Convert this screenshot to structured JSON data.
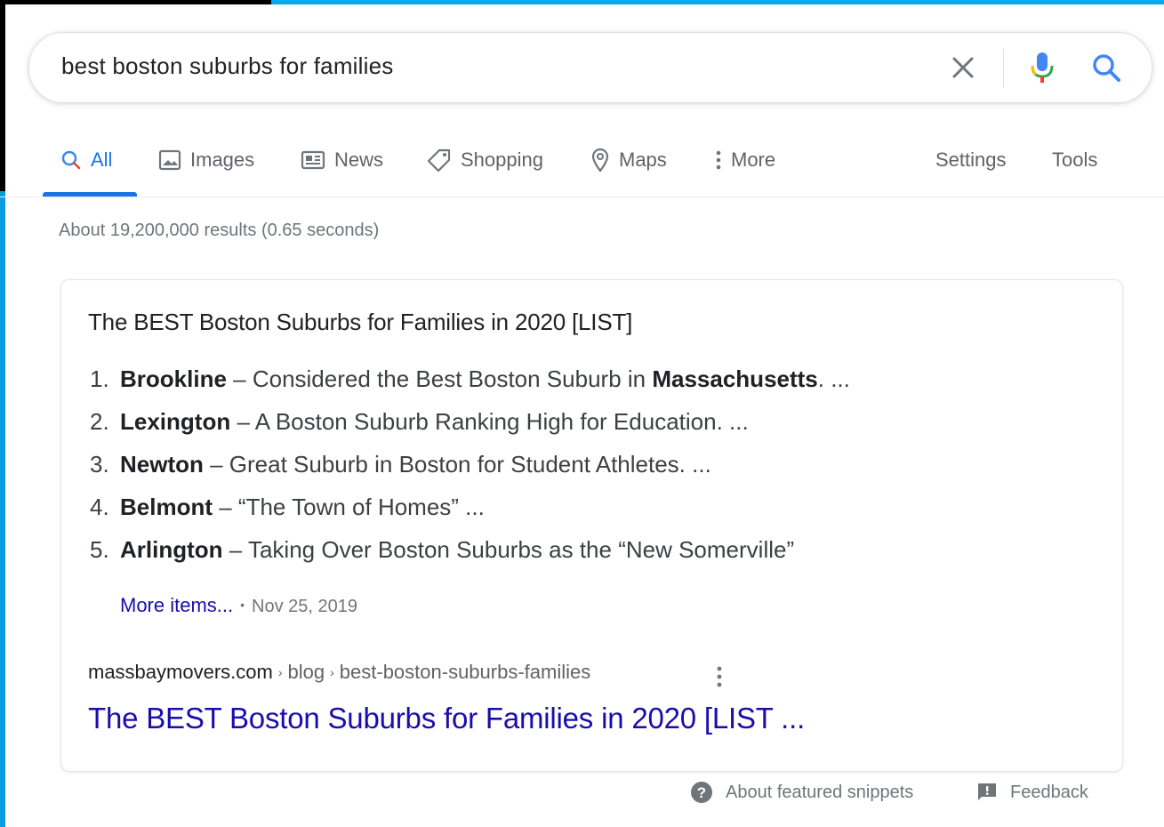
{
  "search": {
    "query": "best boston suburbs for families"
  },
  "tabs": [
    {
      "label": "All",
      "icon": "search-icon",
      "active": true
    },
    {
      "label": "Images",
      "icon": "image-icon"
    },
    {
      "label": "News",
      "icon": "newspaper-icon"
    },
    {
      "label": "Shopping",
      "icon": "tag-icon"
    },
    {
      "label": "Maps",
      "icon": "map-pin-icon"
    },
    {
      "label": "More",
      "icon": "vertical-dots-icon"
    }
  ],
  "tools": {
    "settings": "Settings",
    "tools": "Tools"
  },
  "result_stats": "About 19,200,000 results (0.65 seconds)",
  "snippet": {
    "title": "The BEST Boston Suburbs for Families in 2020 [LIST]",
    "items": [
      {
        "num": "1.",
        "name": "Brookline",
        "pre": " – Considered the Best Boston Suburb in ",
        "bold2": "Massachusetts",
        "post": ". ..."
      },
      {
        "num": "2.",
        "name": "Lexington",
        "pre": " – A Boston Suburb Ranking High for Education. ...",
        "bold2": "",
        "post": ""
      },
      {
        "num": "3.",
        "name": "Newton",
        "pre": " – Great Suburb in Boston for Student Athletes. ...",
        "bold2": "",
        "post": ""
      },
      {
        "num": "4.",
        "name": "Belmont",
        "pre": " – “The Town of Homes” ...",
        "bold2": "",
        "post": ""
      },
      {
        "num": "5.",
        "name": "Arlington",
        "pre": " – Taking Over Boston Suburbs as the “New Somerville”",
        "bold2": "",
        "post": ""
      }
    ],
    "more_items": "More items...",
    "date": "Nov 25, 2019",
    "site": "massbaymovers.com",
    "breadcrumb": [
      "blog",
      "best-boston-suburbs-families"
    ],
    "link_title": "The BEST Boston Suburbs for Families in 2020 [LIST ..."
  },
  "footer": {
    "about": "About featured snippets",
    "feedback": "Feedback"
  },
  "colors": {
    "accent": "#1a73e8",
    "link": "#1a0dab",
    "frame": "#00a9e8"
  }
}
